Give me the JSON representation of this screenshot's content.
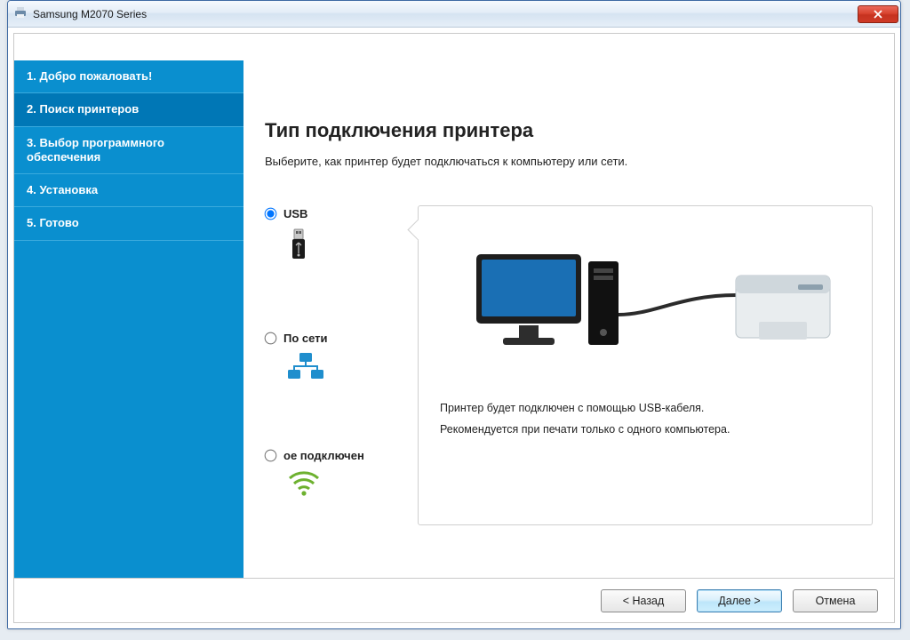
{
  "window": {
    "title": "Samsung M2070 Series",
    "close_label": "Close"
  },
  "sidebar": {
    "steps": [
      {
        "label": "1. Добро пожаловать!"
      },
      {
        "label": "2. Поиск принтеров"
      },
      {
        "label": "3. Выбор программного обеспечения"
      },
      {
        "label": "4. Установка"
      },
      {
        "label": "5. Готово"
      }
    ],
    "active_index": 1
  },
  "main": {
    "heading": "Тип подключения принтера",
    "subheading": "Выберите, как принтер будет подключаться к компьютеру или сети.",
    "options": [
      {
        "id": "usb",
        "label": "USB",
        "icon": "usb-icon",
        "selected": true
      },
      {
        "id": "net",
        "label": "По сети",
        "icon": "network-icon",
        "selected": false
      },
      {
        "id": "wifi",
        "label": "ое подключен",
        "icon": "wifi-icon",
        "selected": false
      }
    ],
    "preview": {
      "line1": "Принтер будет подключен с помощью USB-кабеля.",
      "line2": "Рекомендуется при печати только с одного компьютера."
    }
  },
  "footer": {
    "back": "< Назад",
    "next": "Далее >",
    "cancel": "Отмена"
  },
  "colors": {
    "sidebar": "#0a8fcf",
    "sidebar_active": "#0077b6",
    "close": "#d94430"
  }
}
